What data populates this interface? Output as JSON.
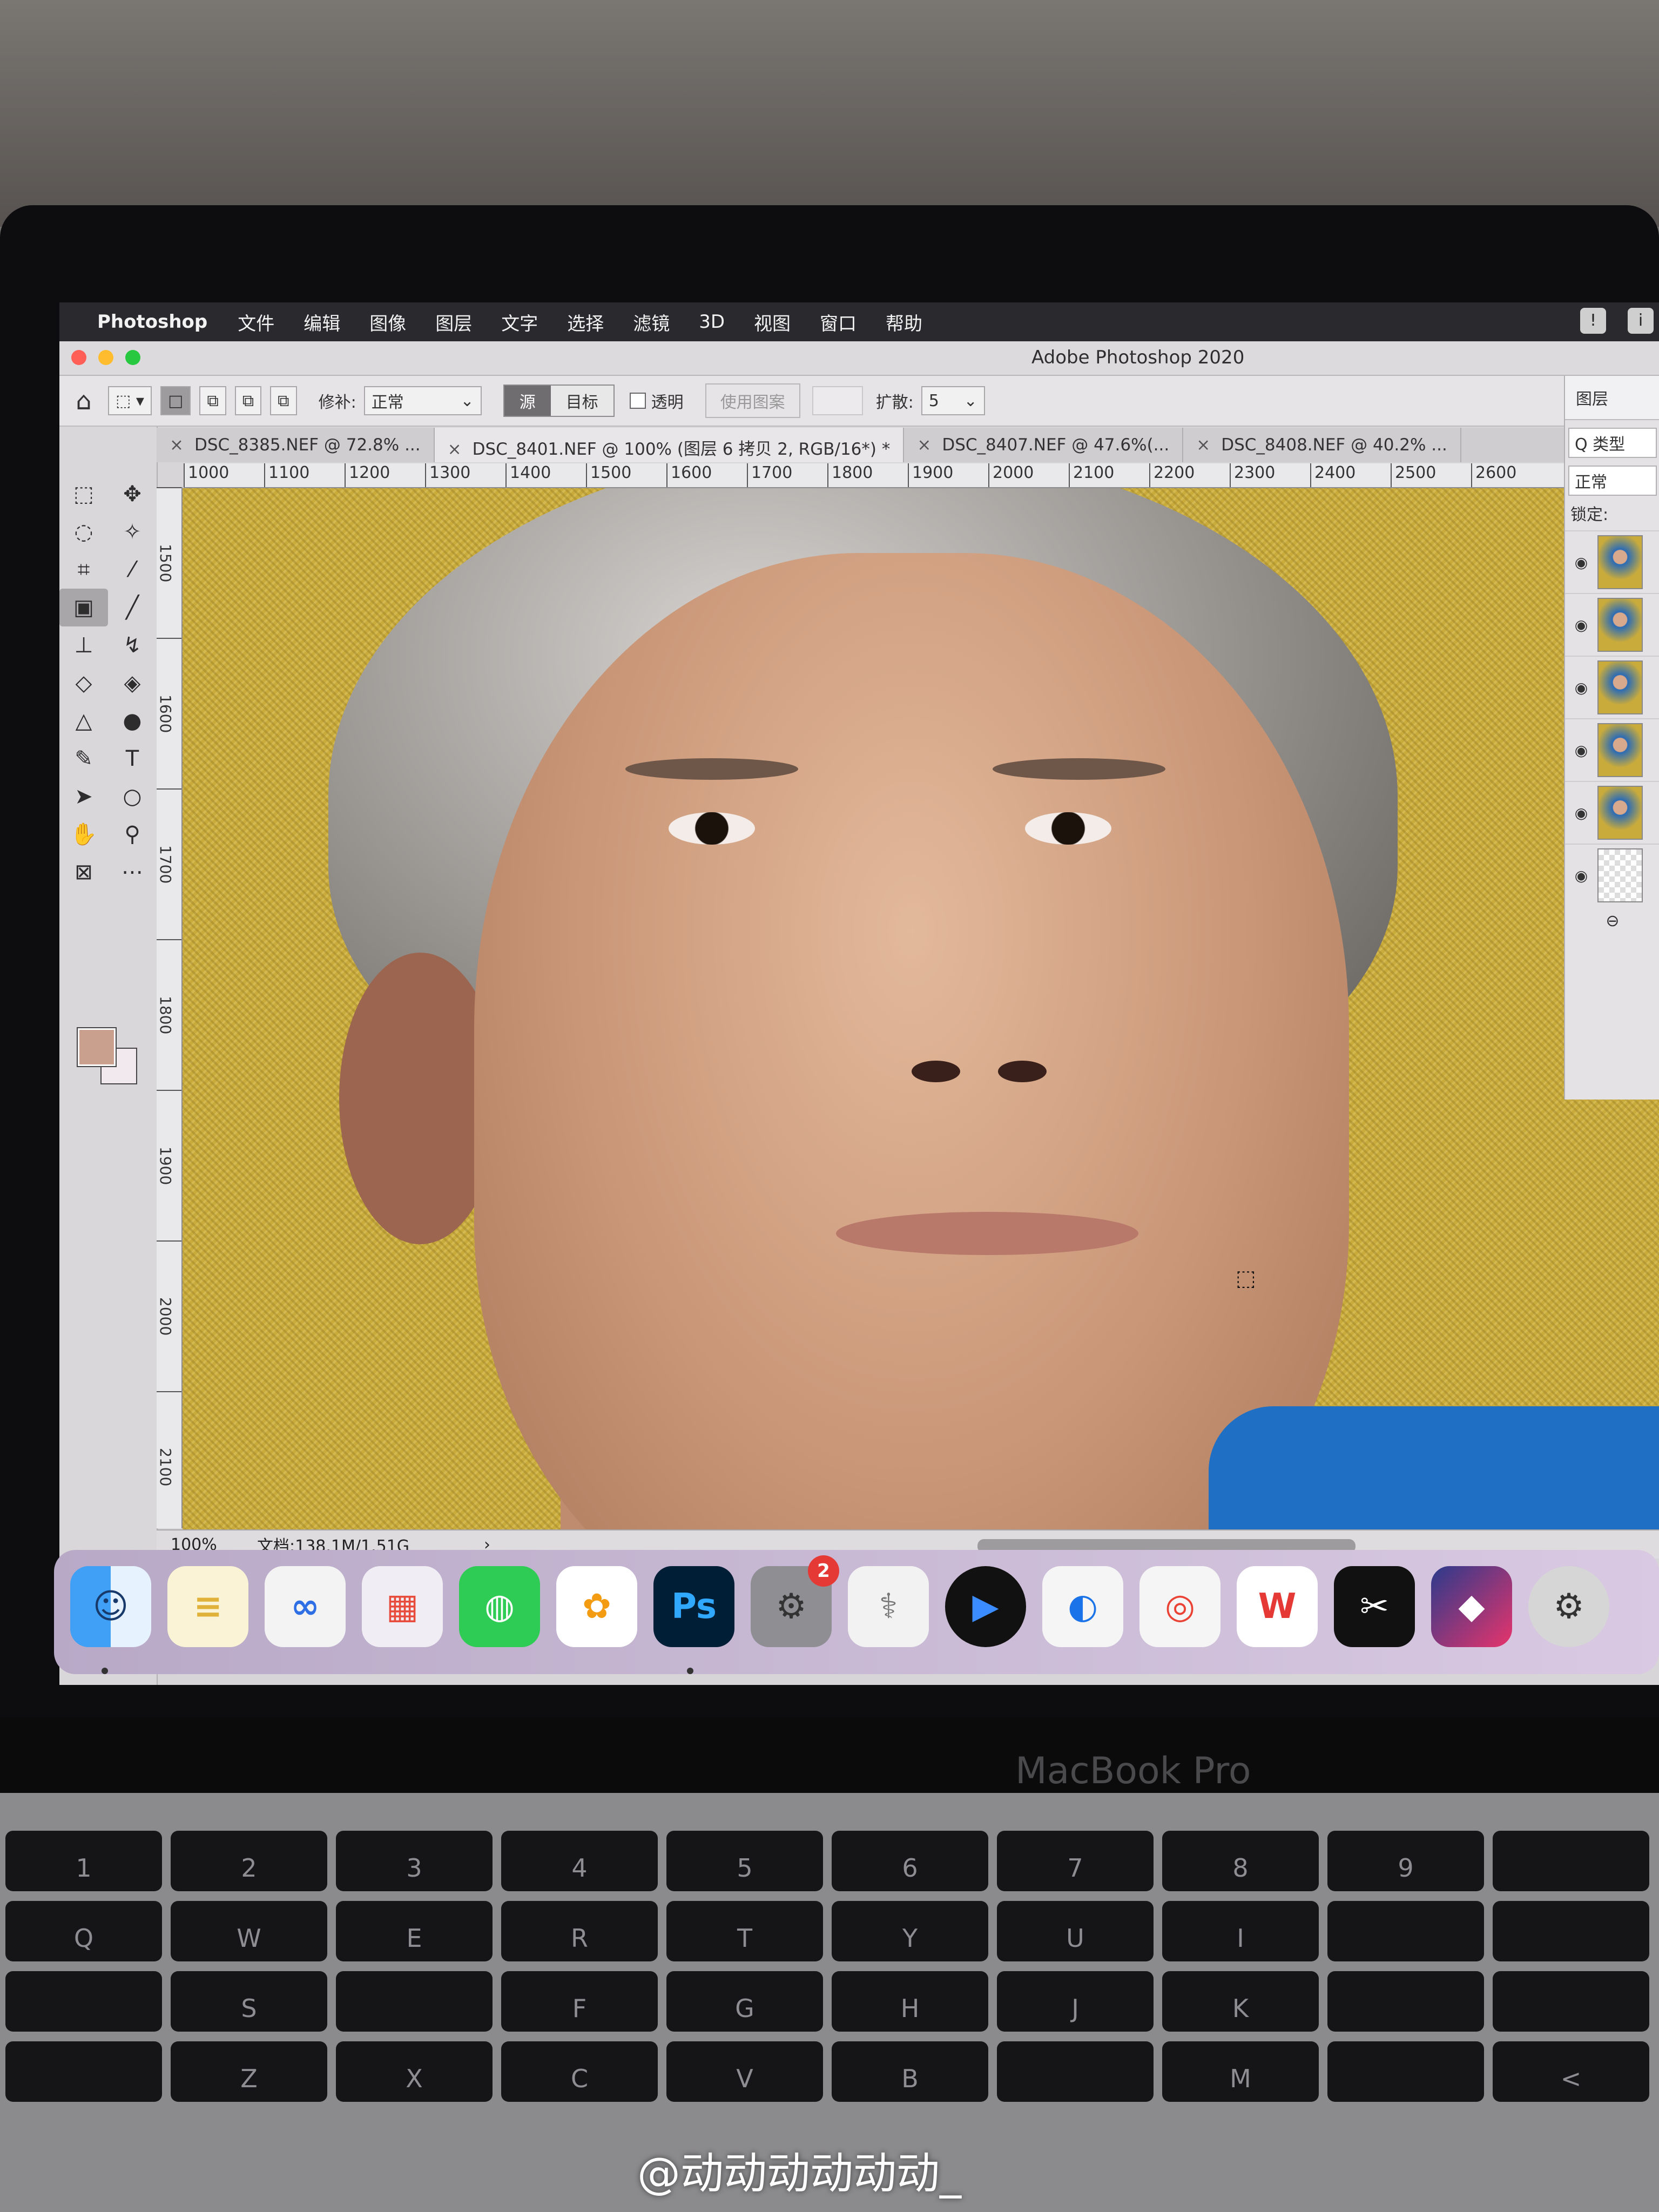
{
  "menubar": {
    "app_name": "Photoshop",
    "items": [
      "文件",
      "编辑",
      "图像",
      "图层",
      "文字",
      "选择",
      "滤镜",
      "3D",
      "视图",
      "窗口",
      "帮助"
    ]
  },
  "window": {
    "title": "Adobe Photoshop 2020"
  },
  "options_bar": {
    "patch_label": "修补:",
    "patch_value": "正常",
    "source_label": "源",
    "target_label": "目标",
    "transparent_label": "透明",
    "use_pattern_label": "使用图案",
    "diffusion_label": "扩散:",
    "diffusion_value": "5"
  },
  "tabs": [
    {
      "label": "DSC_8385.NEF @ 72.8% ..."
    },
    {
      "label": "DSC_8401.NEF @ 100% (图层 6 拷贝 2, RGB/16*) *"
    },
    {
      "label": "DSC_8407.NEF @ 47.6%(..."
    },
    {
      "label": "DSC_8408.NEF @ 40.2% ..."
    }
  ],
  "ruler_h": [
    "1000",
    "1100",
    "1200",
    "1300",
    "1400",
    "1500",
    "1600",
    "1700",
    "1800",
    "1900",
    "2000",
    "2100",
    "2200",
    "2300",
    "2400",
    "2500",
    "2600"
  ],
  "ruler_v": [
    "1500",
    "1600",
    "1700",
    "1800",
    "1900",
    "2000",
    "2100"
  ],
  "status": {
    "zoom": "100%",
    "doc": "文档:138.1M/1.51G"
  },
  "layers_panel": {
    "tab": "图层",
    "search": "Q 类型",
    "blend_mode": "正常",
    "lock_label": "锁定:"
  },
  "dock": {
    "ps_label": "Ps",
    "settings_badge": "2"
  },
  "laptop": {
    "brand": "MacBook Pro"
  },
  "keyboard": [
    "1",
    "2",
    "3",
    "4",
    "5",
    "6",
    "7",
    "8",
    "9",
    "Q",
    "W",
    "E",
    "R",
    "T",
    "Y",
    "U",
    "I",
    "S",
    "F",
    "G",
    "H",
    "J",
    "K",
    "Z",
    "X",
    "C",
    "V",
    "B",
    "M",
    "<"
  ],
  "watermark": "@动动动动动动_",
  "colors": {
    "canvas_bg": "#c9ab3c",
    "foreground": "#c9a08e",
    "shirt": "#1f6fc4"
  }
}
